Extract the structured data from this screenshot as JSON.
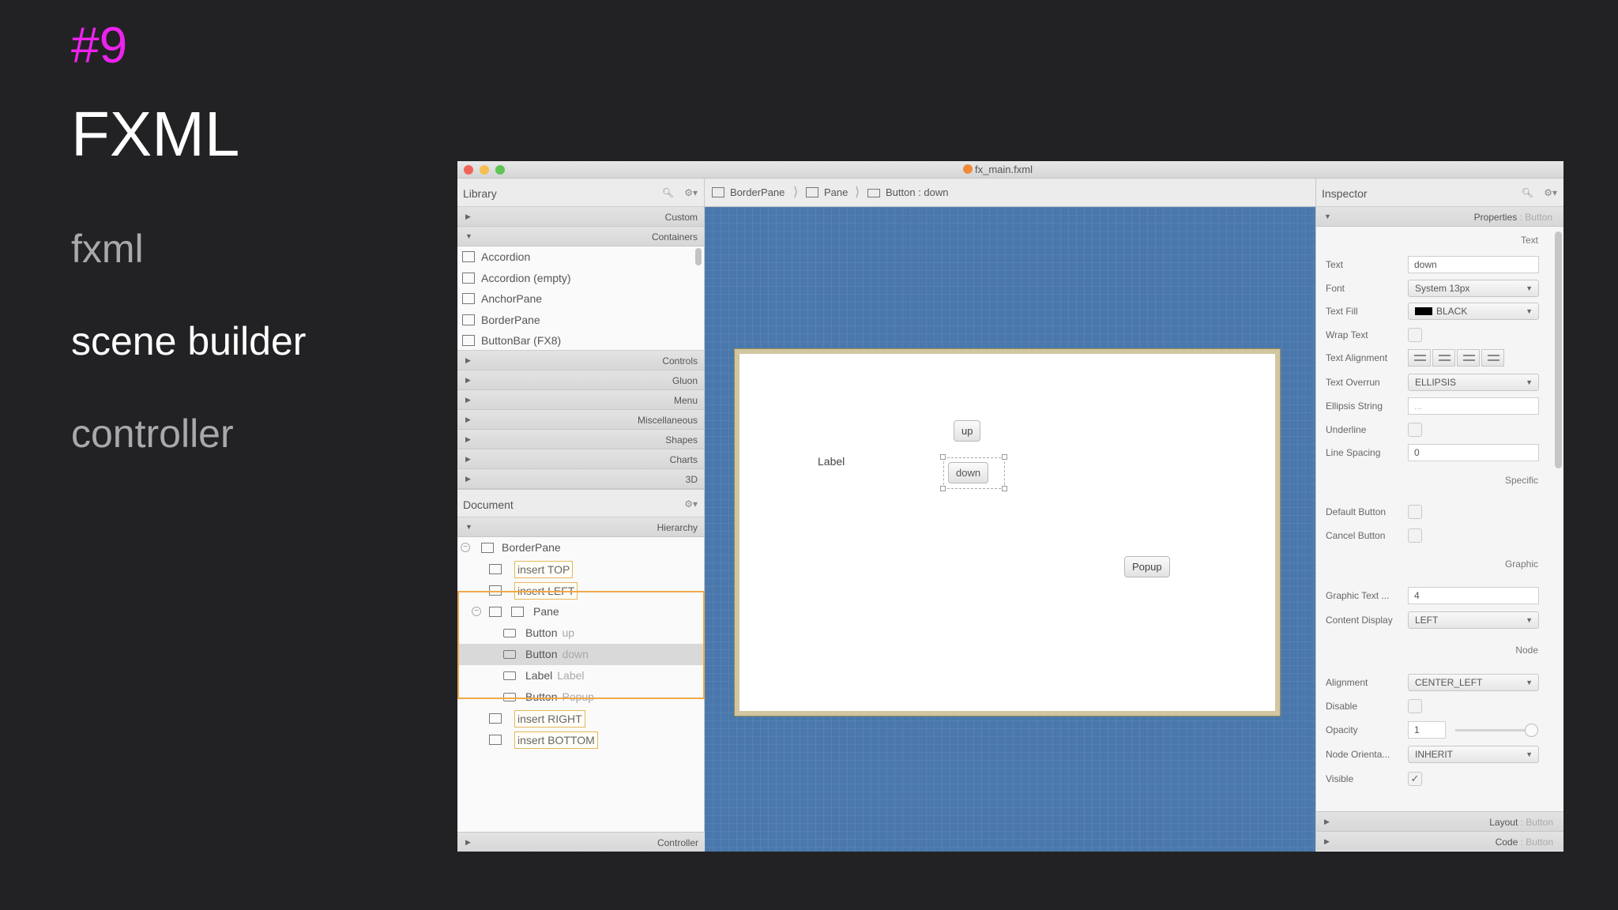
{
  "slide": {
    "number": "#9",
    "title": "FXML",
    "topics": [
      "fxml",
      "scene builder",
      "controller"
    ]
  },
  "colors": {
    "slide_number": "#ee22ee",
    "canvas": "#4a78ac",
    "selection_frame": "#f0a94a"
  },
  "window": {
    "title": "fx_main.fxml"
  },
  "library": {
    "title": "Library",
    "sections_top": [
      "Custom",
      "Containers"
    ],
    "items": [
      "Accordion",
      "Accordion  (empty)",
      "AnchorPane",
      "BorderPane",
      "ButtonBar  (FX8)"
    ],
    "sections_bottom": [
      "Controls",
      "Gluon",
      "Menu",
      "Miscellaneous",
      "Shapes",
      "Charts",
      "3D"
    ]
  },
  "document": {
    "title": "Document",
    "section": "Hierarchy",
    "tree": {
      "root": "BorderPane",
      "insert_top": "insert TOP",
      "insert_left": "insert LEFT",
      "pane": "Pane",
      "children": [
        {
          "type": "Button",
          "name": "up"
        },
        {
          "type": "Button",
          "name": "down"
        },
        {
          "type": "Label",
          "name": "Label"
        },
        {
          "type": "Button",
          "name": "Popup"
        }
      ],
      "insert_right": "insert RIGHT",
      "insert_bottom": "insert BOTTOM"
    },
    "footer": "Controller"
  },
  "breadcrumb": [
    "BorderPane",
    "Pane",
    "Button : down"
  ],
  "canvas": {
    "label": "Label",
    "btn_up": "up",
    "btn_down": "down",
    "btn_popup": "Popup"
  },
  "inspector": {
    "title": "Inspector",
    "properties_header": "Properties",
    "properties_target": ": Button",
    "groups": {
      "text": "Text",
      "specific": "Specific",
      "graphic": "Graphic",
      "node": "Node"
    },
    "props": {
      "text": {
        "label": "Text",
        "value": "down"
      },
      "font": {
        "label": "Font",
        "value": "System 13px"
      },
      "text_fill": {
        "label": "Text Fill",
        "value": "BLACK"
      },
      "wrap_text": {
        "label": "Wrap Text"
      },
      "text_alignment": {
        "label": "Text Alignment"
      },
      "text_overrun": {
        "label": "Text Overrun",
        "value": "ELLIPSIS"
      },
      "ellipsis_string": {
        "label": "Ellipsis String",
        "value": "..."
      },
      "underline": {
        "label": "Underline"
      },
      "line_spacing": {
        "label": "Line Spacing",
        "value": "0"
      },
      "default_button": {
        "label": "Default Button"
      },
      "cancel_button": {
        "label": "Cancel Button"
      },
      "graphic_text_gap": {
        "label": "Graphic Text ...",
        "value": "4"
      },
      "content_display": {
        "label": "Content Display",
        "value": "LEFT"
      },
      "alignment": {
        "label": "Alignment",
        "value": "CENTER_LEFT"
      },
      "disable": {
        "label": "Disable"
      },
      "opacity": {
        "label": "Opacity",
        "value": "1"
      },
      "node_orientation": {
        "label": "Node Orienta...",
        "value": "INHERIT"
      },
      "visible": {
        "label": "Visible",
        "checked": "✓"
      }
    },
    "layout_label": "Layout",
    "layout_target": ": Button",
    "code_label": "Code",
    "code_target": ": Button"
  }
}
